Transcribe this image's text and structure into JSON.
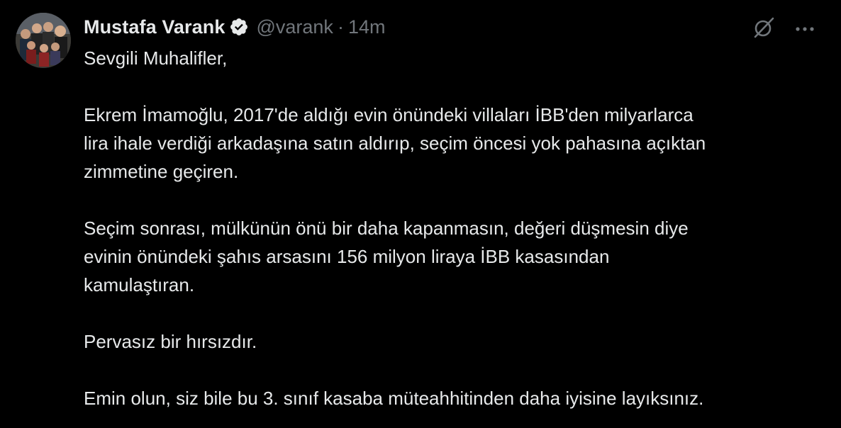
{
  "tweet": {
    "author": {
      "display_name": "Mustafa Varank",
      "handle": "@varank",
      "verified": true
    },
    "separator": "·",
    "time": "14m",
    "paragraphs": [
      "Sevgili Muhalifler,",
      "Ekrem İmamoğlu, 2017'de aldığı evin önündeki villaları İBB'den milyarlarca\nlira ihale verdiği arkadaşına satın aldırıp, seçim öncesi yok pahasına açıktan\nzimmetine geçiren.",
      "Seçim sonrası, mülkünün önü bir daha kapanmasın, değeri düşmesin diye\nevinin önündeki şahıs arsasını 156 milyon liraya İBB kasasından\nkamulaştıran.",
      "Pervasız bir hırsızdır.",
      "Emin olun, siz bile bu 3. sınıf kasaba müteahhitinden daha iyisine layıksınız."
    ]
  },
  "icons": {
    "verified": "verified-badge-icon",
    "grok": "grok-icon",
    "more": "more-icon"
  },
  "colors": {
    "background": "#000000",
    "text": "#e7e9ea",
    "secondary": "#71767b",
    "verified_badge": "#e7e9ea"
  }
}
